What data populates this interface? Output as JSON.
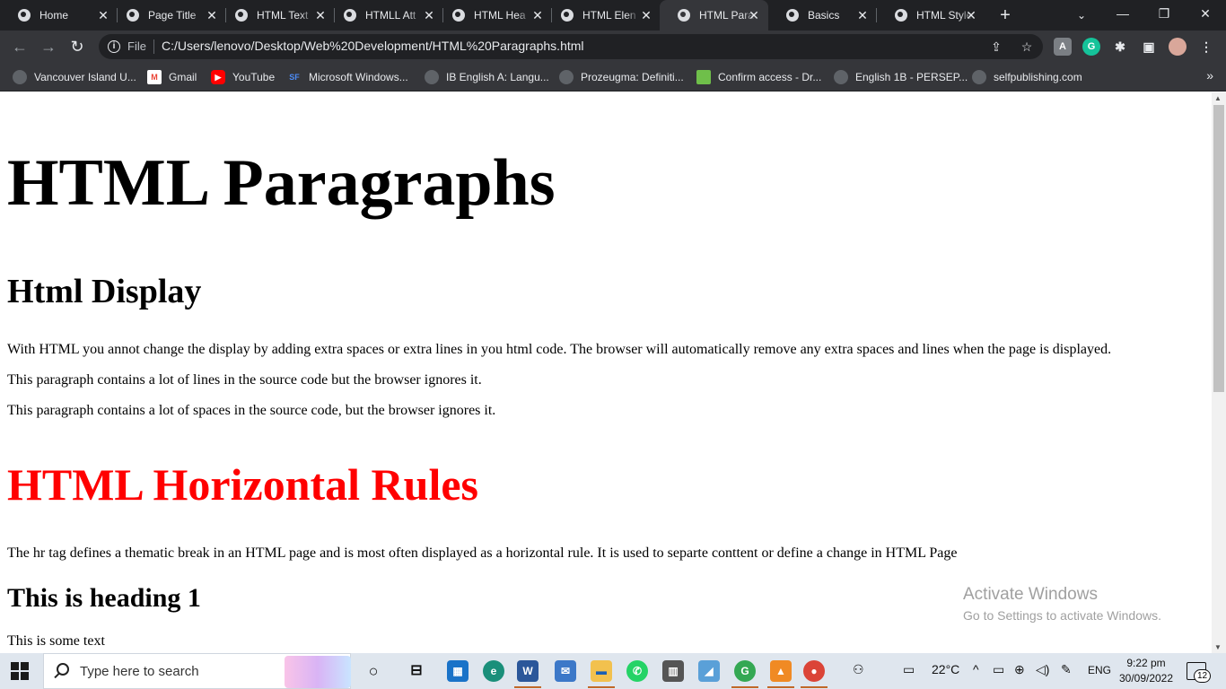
{
  "browser": {
    "tabs": [
      {
        "title": "Home",
        "active": false
      },
      {
        "title": "Page Title",
        "active": false
      },
      {
        "title": "HTML Text",
        "active": false
      },
      {
        "title": "HTMLL Att",
        "active": false
      },
      {
        "title": "HTML Hea",
        "active": false
      },
      {
        "title": "HTML Elen",
        "active": false
      },
      {
        "title": "HTML Para",
        "active": true
      },
      {
        "title": "Basics",
        "active": false
      },
      {
        "title": "HTML Style",
        "active": false
      }
    ],
    "new_tab_symbol": "+",
    "omnibox": {
      "scheme_label": "File",
      "url": "C:/Users/lenovo/Desktop/Web%20Development/HTML%20Paragraphs.html"
    },
    "bookmarks": [
      {
        "label": "Vancouver Island U..."
      },
      {
        "label": "Gmail"
      },
      {
        "label": "YouTube"
      },
      {
        "label": "Microsoft Windows..."
      },
      {
        "label": "IB English A: Langu..."
      },
      {
        "label": "Prozeugma: Definiti..."
      },
      {
        "label": "Confirm access - Dr..."
      },
      {
        "label": "English 1B - PERSEP..."
      },
      {
        "label": "selfpublishing.com"
      }
    ],
    "extensions": [
      {
        "icon": "pdf-icon",
        "glyph": "A",
        "color": "#7b7f84"
      },
      {
        "icon": "grammarly-icon",
        "glyph": "G",
        "color": "#15c39a"
      },
      {
        "icon": "puzzle-icon",
        "glyph": "✱",
        "color": "#35363a"
      },
      {
        "icon": "sidepanel-icon",
        "glyph": "▣",
        "color": "#35363a"
      },
      {
        "icon": "profile-avatar",
        "glyph": "",
        "color": "#d9a79a"
      }
    ]
  },
  "page": {
    "title": "HTML Paragraphs",
    "display_heading": "Html Display",
    "display_paragraphs": [
      "With HTML you annot change the display by adding extra spaces or extra lines in you html code. The browser will automatically remove any extra spaces and lines when the page is displayed.",
      "This paragraph contains a lot of lines in the source code but the browser ignores it.",
      "This paragraph contains a lot of spaces in the source code, but the browser ignores it."
    ],
    "rules_heading": "HTML Horizontal Rules",
    "rules_heading_color": "#ff0000",
    "rules_paragraph": "The hr tag defines a thematic break in an HTML page and is most often displayed as a horizontal rule. It is used to separte conttent or define a change in HTML Page",
    "heading1": "This is heading 1",
    "some_text": "This is some text"
  },
  "watermark": {
    "title": "Activate Windows",
    "subtitle": "Go to Settings to activate Windows."
  },
  "taskbar": {
    "search_placeholder": "Type here to search",
    "weather": "22°C",
    "language": "ENG",
    "time": "9:22 pm",
    "date": "30/09/2022",
    "notification_count": "12"
  }
}
